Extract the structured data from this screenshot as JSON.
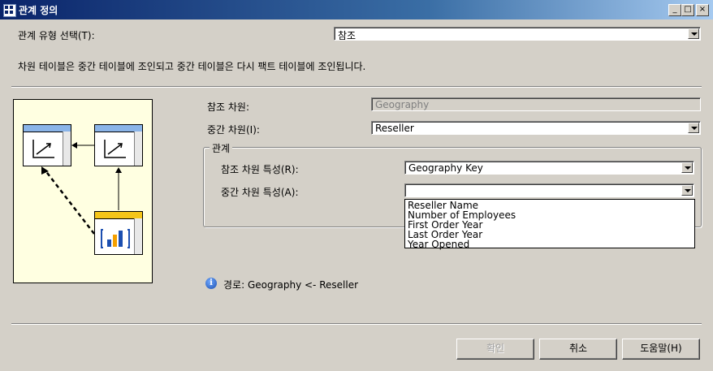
{
  "window": {
    "title": "관계 정의",
    "buttons": [
      "_",
      "□",
      "×"
    ]
  },
  "relation_type": {
    "label": "관계 유형 선택(T):",
    "value": "참조"
  },
  "description": "차원 테이블은 중간 테이블에 조인되고 중간 테이블은 다시 팩트 테이블에 조인됩니다.",
  "reference_dimension": {
    "label": "참조 차원:",
    "value": "Geography"
  },
  "intermediate_dimension": {
    "label": "중간 차원(I):",
    "value": "Reseller"
  },
  "relationship": {
    "group_label": "관계",
    "ref_attr": {
      "label": "참조 차원 특성(R):",
      "value": "Geography Key"
    },
    "inter_attr": {
      "label": "중간 차원 특성(A):",
      "value": ""
    },
    "dropdown_options": [
      "Reseller Name",
      "Number of Employees",
      "First Order Year",
      "Last Order Year",
      "Year Opened"
    ]
  },
  "path_text": "경로: Geography <- Reseller",
  "footer": {
    "ok": "확인",
    "cancel": "취소",
    "help": "도움말(H)"
  },
  "colors": {
    "titlebar": "#0a246a",
    "diagram_bg": "#ffffe1",
    "dim_header": "#8ab4e8",
    "fact_header": "#f5c518"
  }
}
